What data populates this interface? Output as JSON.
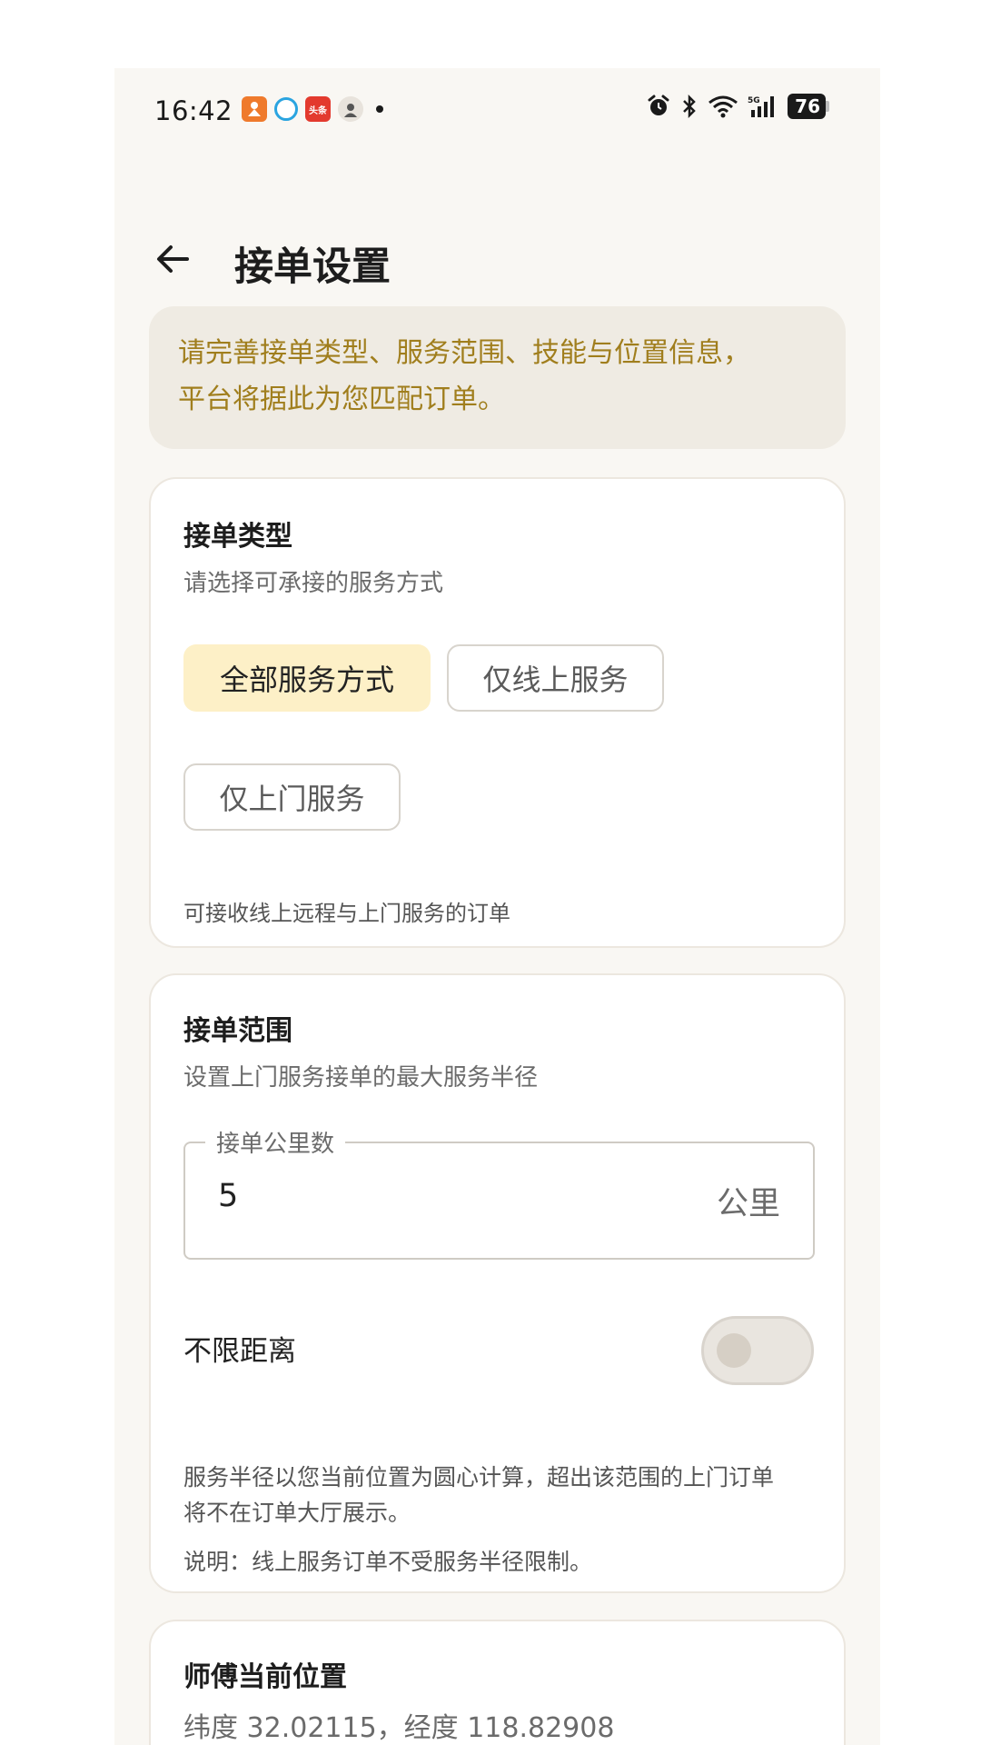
{
  "status_bar": {
    "time": "16:42",
    "notif_icon_c": "头条",
    "battery": "76"
  },
  "header": {
    "title": "接单设置"
  },
  "tip": {
    "line1": "请完善接单类型、服务范围、技能与位置信息，",
    "line2": "平台将据此为您匹配订单。"
  },
  "order_type": {
    "title": "接单类型",
    "subtitle": "请选择可承接的服务方式",
    "options": [
      "全部服务方式",
      "仅线上服务",
      "仅上门服务"
    ],
    "selected": "全部服务方式",
    "hint": "可接收线上远程与上门服务的订单"
  },
  "order_range": {
    "title": "接单范围",
    "subtitle": "设置上门服务接单的最大服务半径",
    "field_label": "接单公里数",
    "field_value": "5",
    "field_unit": "公里",
    "toggle_label": "不限距离",
    "toggle_on": false,
    "desc_line1": "服务半径以您当前位置为圆心计算，超出该范围的上门订单",
    "desc_line2": "将不在订单大厅展示。",
    "note": "说明：线上服务订单不受服务半径限制。"
  },
  "location": {
    "title": "师傅当前位置",
    "coords": "纬度 32.02115，经度 118.82908"
  },
  "colors": {
    "accent_text": "#a07e1d",
    "chip_selected_bg": "#fdf0c7",
    "page_bg": "#f9f7f3"
  }
}
